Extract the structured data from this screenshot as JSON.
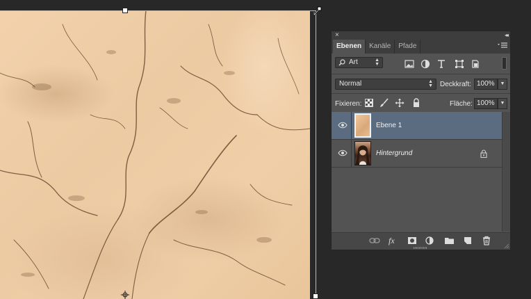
{
  "panel": {
    "close_label": "×",
    "collapse_label": "◂◂",
    "tabs": [
      {
        "label": "Ebenen",
        "active": true
      },
      {
        "label": "Kanäle",
        "active": false
      },
      {
        "label": "Pfade",
        "active": false
      }
    ],
    "filter": {
      "kind_label": "Art"
    },
    "blend_mode": "Normal",
    "opacity_label": "Deckkraft:",
    "opacity_value": "100%",
    "lock_label": "Fixieren:",
    "fill_label": "Fläche:",
    "fill_value": "100%",
    "layers": [
      {
        "name": "Ebene 1",
        "selected": true,
        "visible": true,
        "italic": false,
        "locked": false
      },
      {
        "name": "Hintergrund",
        "selected": false,
        "visible": true,
        "italic": true,
        "locked": true
      }
    ],
    "bottom_icons": [
      "link-icon",
      "fx-icon",
      "mask-icon",
      "adjustment-icon",
      "folder-icon",
      "new-layer-icon",
      "trash-icon"
    ],
    "fx_label": "fx"
  },
  "colors": {
    "selection": "#5b6b80",
    "panel_bg": "#535353",
    "app_bg": "#282828",
    "canvas": "#f0cfa8"
  }
}
